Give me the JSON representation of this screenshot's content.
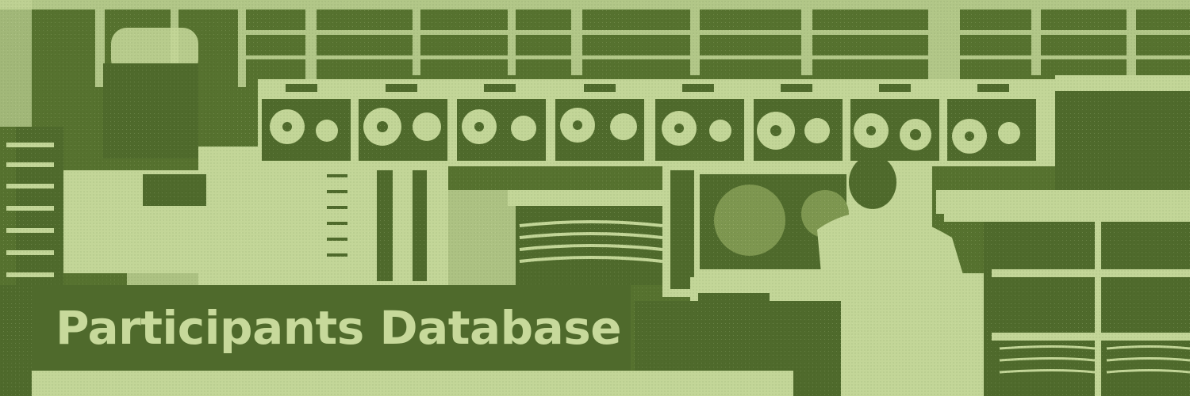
{
  "banner": {
    "title": "Participants Database"
  },
  "colors": {
    "dark_olive": "#4f6a2c",
    "light_green": "#c7d99b"
  },
  "image": {
    "icon": "vintage-computer-room-photo"
  }
}
